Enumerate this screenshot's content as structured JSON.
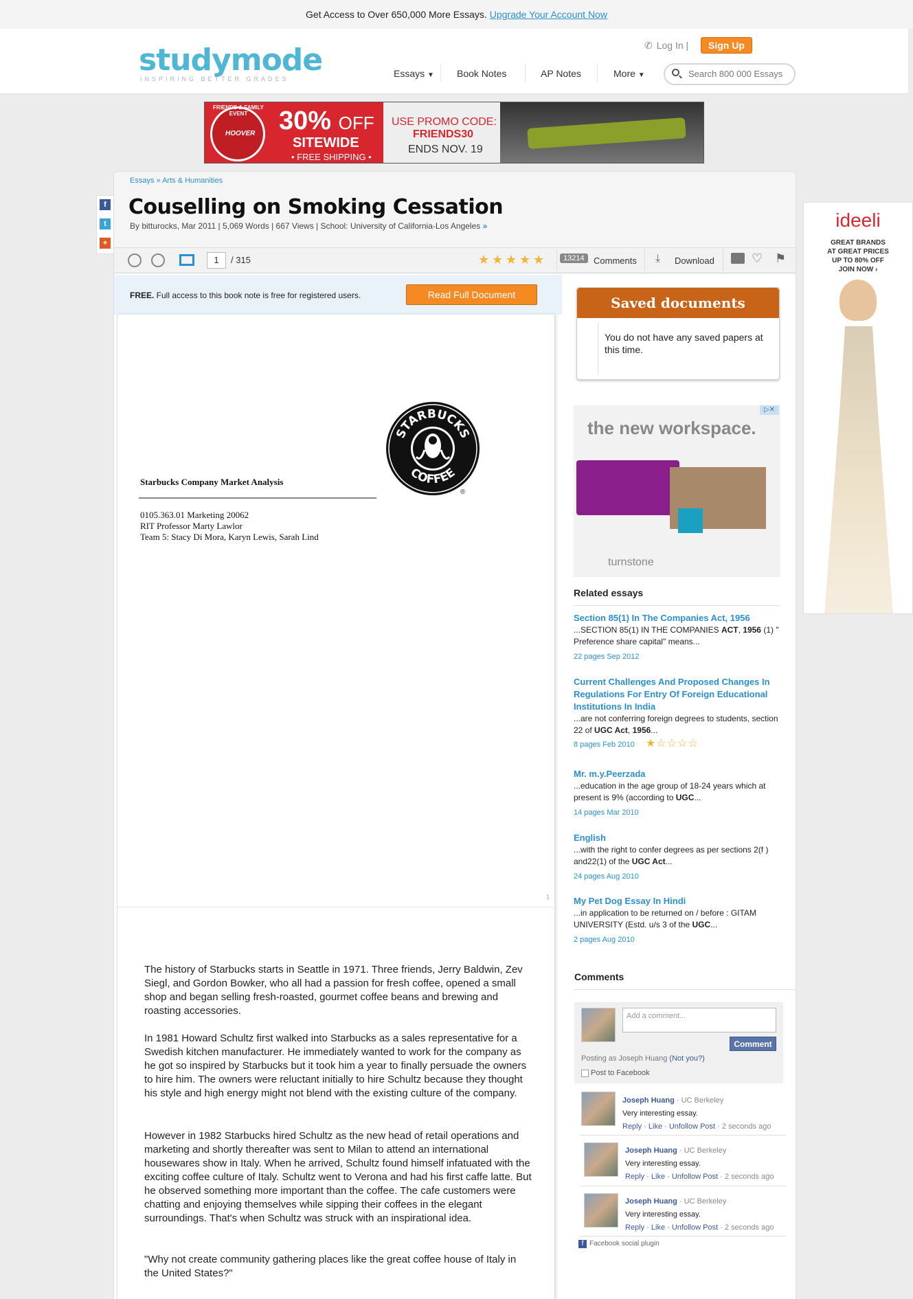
{
  "promo_bar": {
    "text": "Get Access to Over 650,000 More Essays.",
    "link": "Upgrade Your Account Now"
  },
  "header": {
    "logo": "studymode",
    "tagline": "INSPIRING BETTER GRADES",
    "login": "Log In |",
    "signup": "Sign Up",
    "nav": [
      "Essays",
      "Book Notes",
      "AP Notes",
      "More"
    ],
    "search_placeholder": "Search 800 000 Essays"
  },
  "ad_banner": {
    "event_text": "FRIENDS & FAMILY EVENT",
    "brand": "HOOVER",
    "discount": "30%",
    "off": "OFF",
    "sitewide": "SITEWIDE",
    "shipping": "• FREE SHIPPING •",
    "promo_label": "USE PROMO CODE:",
    "promo_code": "FRIENDS30",
    "ends": "ENDS NOV. 19"
  },
  "breadcrumb": "Essays » Arts & Humanities",
  "essay": {
    "title": "Couselling on Smoking Cessation",
    "meta": "By bitturocks, Mar 2011 | 5,069 Words | 667 Views | School: University of California-Los Angeles",
    "meta_more": "»"
  },
  "toolbar": {
    "page": "1",
    "page_total": "/  315",
    "stars": [
      "★",
      "★",
      "★",
      "★",
      "★"
    ],
    "comment_count": "13214",
    "comments": "Comments",
    "download": "Download"
  },
  "free_bar": {
    "bold": "FREE.",
    "text": " Full access to this book note is free for registered users.",
    "button": "Read Full Document"
  },
  "document": {
    "heading": "Starbucks Company Market Analysis",
    "lines": [
      "0105.363.01 Marketing 20062",
      "RIT Professor Marty Lawlor",
      "Team 5:  Stacy Di Mora, Karyn Lewis, Sarah Lind"
    ],
    "logo_top": "STARBUCKS",
    "logo_bottom": "COFFEE",
    "logo_mark": "®",
    "page_number": "1",
    "paragraphs": [
      "The history of Starbucks starts in Seattle in 1971. Three friends, Jerry Baldwin, Zev Siegl, and Gordon Bowker, who all had a passion for fresh coffee, opened a small shop and began selling fresh-roasted, gourmet coffee beans and brewing and roasting accessories.",
      "In 1981 Howard Schultz first walked into Starbucks as a sales representative for a Swedish kitchen manufacturer. He immediately wanted to work for the company as he got so inspired by Starbucks but it took him a year to finally persuade the owners to hire him. The owners were reluctant initially to hire Schultz because they thought his style and high energy might not blend with the existing culture of the company.",
      "However in 1982 Starbucks hired Schultz as the new head of retail operations and marketing and shortly thereafter was sent to Milan to attend an international housewares show in Italy. When he arrived, Schultz found himself infatuated with the exciting coffee culture of Italy. Schultz went to Verona and had his first caffe latte. But he observed something more important than the coffee. The cafe customers were chatting and enjoying themselves while sipping their coffees in the elegant surroundings. That's when Schultz was struck with an inspirational idea.",
      "\"Why not create community gathering places like the great coffee house of Italy in the United States?\""
    ]
  },
  "saved_documents": {
    "title": "Saved documents",
    "text": "You do not have any saved papers at this time."
  },
  "ad_workspace": {
    "headline": "the new workspace.",
    "brand": "turnstone"
  },
  "related": {
    "heading": "Related essays",
    "items": [
      {
        "title": "Section 85(1) In The Companies Act, 1956",
        "snippet_html": "...SECTION 85(1) IN THE COMPANIES <b>ACT</b>, <b>1956</b> (1) \" Preference share capital\" means...",
        "meta": "22 pages    Sep 2012"
      },
      {
        "title": "Current Challenges And Proposed Changes In Regulations For Entry Of Foreign Educational Institutions In India",
        "snippet_html": "...are not conferring foreign degrees to students, section 22 of <b>UGC Act</b>, <b>1956</b>...",
        "meta": "8 pages    Feb 2010"
      },
      {
        "title": "Mr. m.y.Peerzada",
        "snippet_html": "...education in the age group of 18-24 years which at present is 9% (according to <b>UGC</b>...",
        "meta": "14 pages    Mar 2010"
      },
      {
        "title": "English",
        "snippet_html": "...with the right to confer degrees as per sections 2(f ) and22(1) of the <b>UGC Act</b>...",
        "meta": "24 pages    Aug 2010"
      },
      {
        "title": "My Pet Dog Essay In Hindi",
        "snippet_html": "...in application to be returned on / before : GITAM UNIVERSITY (Estd. u/s 3 of the <b>UGC</b>...",
        "meta": "2 pages    Aug 2010"
      }
    ],
    "item2_rating": "★☆☆☆☆"
  },
  "comments": {
    "heading": "Comments",
    "placeholder": "Add a comment...",
    "button": "Comment",
    "posting_as": "Posting as Joseph Huang ",
    "not_you": "(Not you?)",
    "post_to_facebook": "Post to Facebook",
    "items": [
      {
        "name": "Joseph Huang",
        "school": " · UC Berkeley",
        "text": "Very interesting essay.",
        "actions": "Reply · Like · Unfollow Post",
        "time": " · 2 seconds ago"
      },
      {
        "name": "Joseph Huang",
        "school": " · UC Berkeley",
        "text": "Very interesting essay.",
        "actions": "Reply · Like · Unfollow Post",
        "time": " · 2 seconds ago"
      },
      {
        "name": "Joseph Huang",
        "school": " · UC Berkeley",
        "text": "Very interesting essay.",
        "actions": "Reply · Like · Unfollow Post",
        "time": " · 2 seconds ago"
      }
    ],
    "plugin": "Facebook social plugin"
  },
  "social": [
    "f",
    "t",
    "+"
  ],
  "ad_ideeli": {
    "brand": "ideeli",
    "lines": [
      "GREAT BRANDS",
      "AT GREAT PRICES",
      "UP TO 80% OFF",
      "JOIN NOW ›"
    ]
  },
  "colors": {
    "accent": "#2a8fd0",
    "orange": "#f58a22",
    "facebook": "#3b5998"
  }
}
